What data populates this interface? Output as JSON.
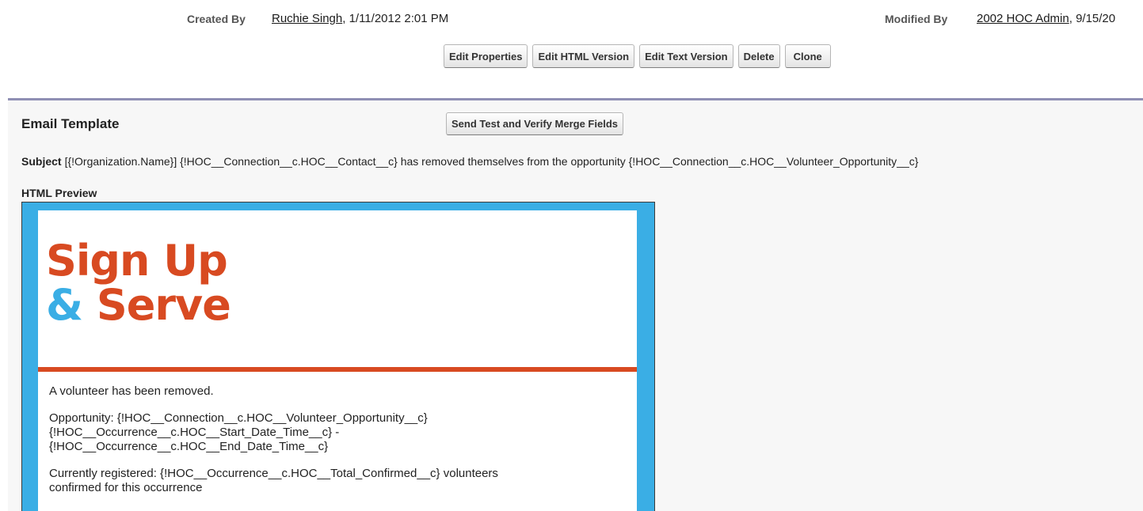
{
  "header": {
    "created_by_label": "Created By",
    "created_by_user": "Ruchie Singh",
    "created_by_date": ", 1/11/2012 2:01 PM",
    "modified_by_label": "Modified By",
    "modified_by_user": "2002 HOC Admin",
    "modified_by_date": ", 9/15/20"
  },
  "toolbar": {
    "edit_properties": "Edit Properties",
    "edit_html": "Edit HTML Version",
    "edit_text": "Edit Text Version",
    "delete": "Delete",
    "clone": "Clone"
  },
  "panel": {
    "title": "Email Template",
    "send_test": "Send Test and Verify Merge Fields",
    "subject_label": "Subject",
    "subject_value": "[{!Organization.Name}] {!HOC__Connection__c.HOC__Contact__c} has removed themselves from the opportunity {!HOC__Connection__c.HOC__Volunteer_Opportunity__c}",
    "preview_label": "HTML Preview"
  },
  "preview": {
    "logo_line1": "Sign Up",
    "logo_amp": "&",
    "logo_line2": "Serve",
    "line_removed": "A volunteer has been removed.",
    "opportunity": "Opportunity: {!HOC__Connection__c.HOC__Volunteer_Opportunity__c}",
    "start": "{!HOC__Occurrence__c.HOC__Start_Date_Time__c} -",
    "end": "{!HOC__Occurrence__c.HOC__End_Date_Time__c}",
    "registered_1": "Currently registered: {!HOC__Occurrence__c.HOC__Total_Confirmed__c} volunteers",
    "registered_2": "confirmed for this occurrence"
  },
  "colors": {
    "brand_orange": "#d84a21",
    "brand_blue": "#3aaee5",
    "panel_border": "#8f8fb4"
  }
}
